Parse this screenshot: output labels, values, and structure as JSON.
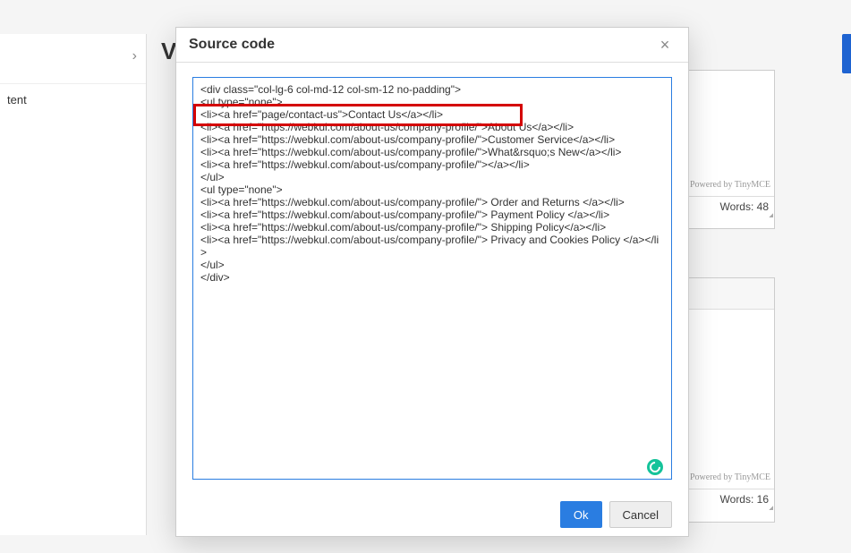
{
  "sidebar": {
    "chevron_icon": "›",
    "item_label": "tent"
  },
  "page_title_fragment": "V",
  "editor1": {
    "powered_by": "Powered by TinyMCE",
    "words_label": "Words: 48"
  },
  "editor2": {
    "powered_by": "Powered by TinyMCE",
    "words_label": "Words: 16"
  },
  "modal": {
    "title": "Source code",
    "close_icon": "×",
    "source_lines": "<div class=\"col-lg-6 col-md-12 col-sm-12 no-padding\">\n<ul type=\"none\">\n<li><a href=\"page/contact-us\">Contact Us</a></li>\n<li><a href=\"https://webkul.com/about-us/company-profile/\">About Us</a></li>\n<li><a href=\"https://webkul.com/about-us/company-profile/\">Customer Service</a></li>\n<li><a href=\"https://webkul.com/about-us/company-profile/\">What&rsquo;s New</a></li>\n<li><a href=\"https://webkul.com/about-us/company-profile/\"></a></li>\n</ul>\n<ul type=\"none\">\n<li><a href=\"https://webkul.com/about-us/company-profile/\"> Order and Returns </a></li>\n<li><a href=\"https://webkul.com/about-us/company-profile/\"> Payment Policy </a></li>\n<li><a href=\"https://webkul.com/about-us/company-profile/\"> Shipping Policy</a></li>\n<li><a href=\"https://webkul.com/about-us/company-profile/\"> Privacy and Cookies Policy </a></li>\n</ul>\n</div>",
    "ok_label": "Ok",
    "cancel_label": "Cancel",
    "grammarly_name": "grammarly"
  }
}
